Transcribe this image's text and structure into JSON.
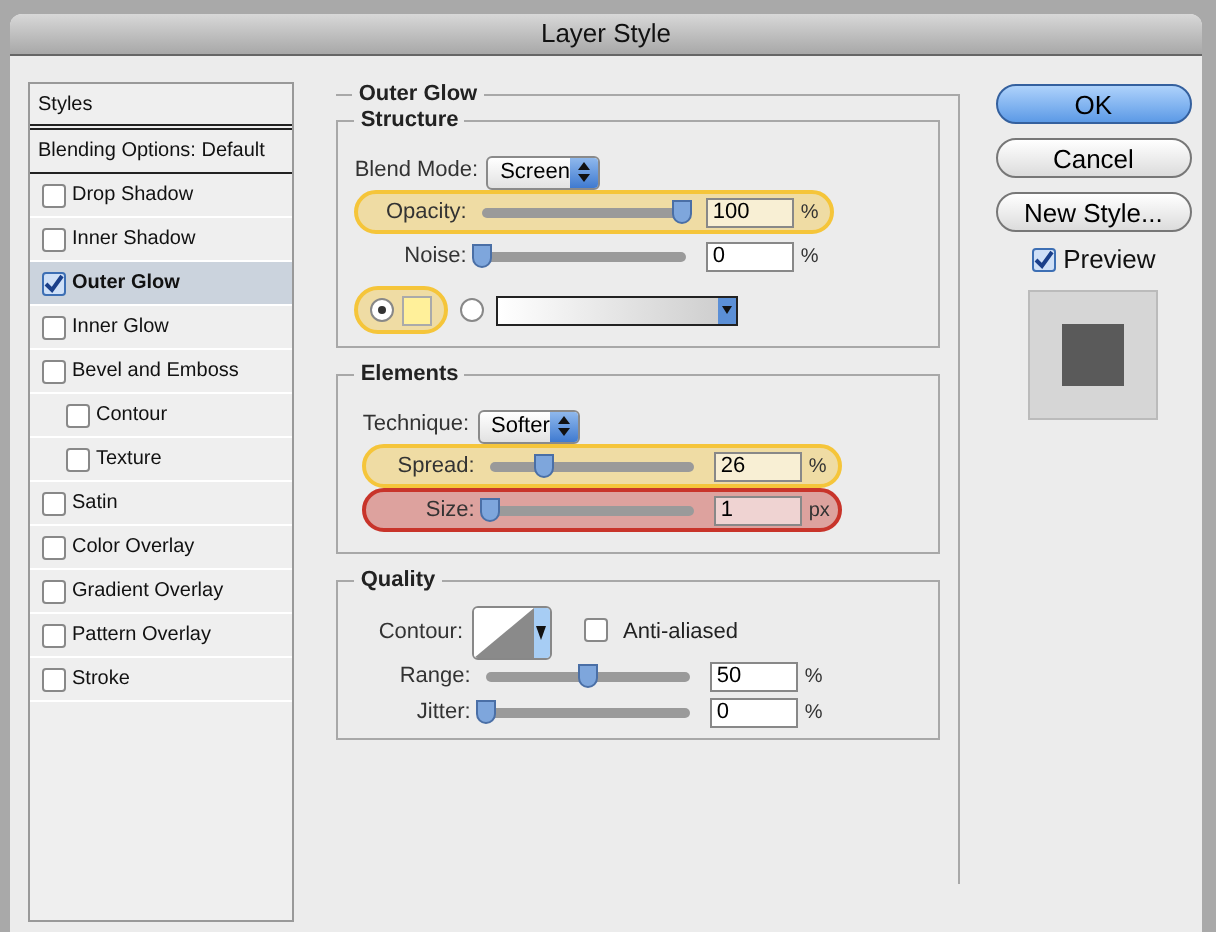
{
  "window": {
    "title": "Layer Style"
  },
  "sidebar": {
    "header": "Styles",
    "blending": "Blending Options: Default",
    "items": [
      {
        "label": "Drop Shadow",
        "checked": false,
        "selected": false
      },
      {
        "label": "Inner Shadow",
        "checked": false,
        "selected": false
      },
      {
        "label": "Outer Glow",
        "checked": true,
        "selected": true
      },
      {
        "label": "Inner Glow",
        "checked": false,
        "selected": false
      },
      {
        "label": "Bevel and Emboss",
        "checked": false,
        "selected": false,
        "children": [
          {
            "label": "Contour",
            "checked": false,
            "selected": false
          },
          {
            "label": "Texture",
            "checked": false,
            "selected": false
          }
        ]
      },
      {
        "label": "Satin",
        "checked": false,
        "selected": false
      },
      {
        "label": "Color Overlay",
        "checked": false,
        "selected": false
      },
      {
        "label": "Gradient Overlay",
        "checked": false,
        "selected": false
      },
      {
        "label": "Pattern Overlay",
        "checked": false,
        "selected": false
      },
      {
        "label": "Stroke",
        "checked": false,
        "selected": false
      }
    ]
  },
  "panel": {
    "title": "Outer Glow",
    "structure": {
      "title": "Structure",
      "blend_mode": {
        "label": "Blend Mode:",
        "value": "Screen"
      },
      "sliders": [
        {
          "label": "Opacity:",
          "level": 0.98,
          "value": "100",
          "unit": "%",
          "highlighted": true,
          "color": "#f5c53a"
        },
        {
          "label": "Noise:",
          "level": 0.0,
          "value": "0",
          "unit": "%",
          "highlighted": false
        }
      ],
      "source": {
        "color_selected": true,
        "gradient_selected": false,
        "highlighted": true,
        "color": "#f5c53a"
      }
    },
    "elements": {
      "title": "Elements",
      "technique": {
        "label": "Technique:",
        "value": "Softer"
      },
      "sliders": [
        {
          "label": "Spread:",
          "level": 0.26,
          "value": "26",
          "unit": "%",
          "highlighted": true,
          "color": "#f5c53a"
        },
        {
          "label": "Size:",
          "level": 0.0,
          "value": "1",
          "unit": "px",
          "highlighted": true,
          "color": "#c8342a"
        }
      ]
    },
    "quality": {
      "title": "Quality",
      "contour_label": "Contour:",
      "anti_aliased": {
        "label": "Anti-aliased",
        "checked": false
      },
      "sliders": [
        {
          "label": "Range:",
          "level": 0.5,
          "value": "50",
          "unit": "%",
          "highlighted": false
        },
        {
          "label": "Jitter:",
          "level": 0.0,
          "value": "0",
          "unit": "%",
          "highlighted": false
        }
      ]
    }
  },
  "buttons": [
    {
      "label": "OK",
      "default": true
    },
    {
      "label": "Cancel",
      "default": false
    },
    {
      "label": "New Style...",
      "default": false
    }
  ],
  "preview": {
    "label": "Preview",
    "checked": true
  }
}
